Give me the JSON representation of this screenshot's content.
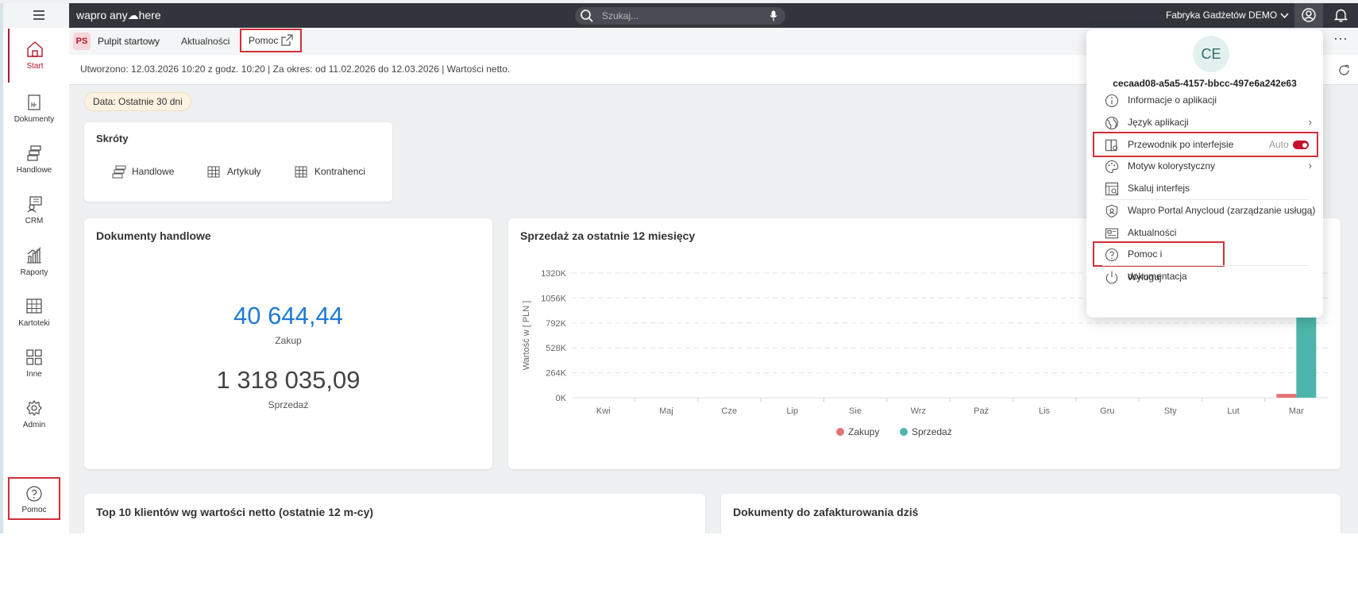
{
  "topbar": {
    "menu_icon": "hamburger-icon",
    "logo": "wapro any☁here",
    "search_placeholder": "Szukaj...",
    "company": "Fabryka Gadżetów DEMO"
  },
  "sidebar": {
    "items": [
      {
        "label": "Start",
        "icon": "home-icon"
      },
      {
        "label": "Dokumenty",
        "icon": "document-icon"
      },
      {
        "label": "Handlowe",
        "icon": "trade-icon"
      },
      {
        "label": "CRM",
        "icon": "crm-icon"
      },
      {
        "label": "Raporty",
        "icon": "chart-icon"
      },
      {
        "label": "Kartoteki",
        "icon": "grid-icon"
      },
      {
        "label": "Inne",
        "icon": "apps-icon"
      },
      {
        "label": "Admin",
        "icon": "admin-gear-icon"
      },
      {
        "label": "Pomoc",
        "icon": "help-icon"
      }
    ]
  },
  "tabs": {
    "badge": "PS",
    "items": [
      "Pulpit startowy",
      "Aktualności",
      "Pomoc"
    ]
  },
  "info": {
    "text": "Utworzono: 12.03.2026 10:20 z godz. 10:20 | Za okres: od 11.02.2026 do 12.03.2026 | Wartości netto."
  },
  "filter_chip": "Data: Ostatnie 30 dni",
  "shortcuts": {
    "title": "Skróty",
    "items": [
      "Handlowe",
      "Artykuły",
      "Kontrahenci"
    ]
  },
  "docs_card": {
    "title": "Dokumenty handlowe",
    "purchase_value": "40 644,44",
    "purchase_label": "Zakup",
    "sales_value": "1 318 035,09",
    "sales_label": "Sprzedaż"
  },
  "sales_card": {
    "title": "Sprzedaż za ostatnie 12 miesięcy"
  },
  "chart_data": {
    "type": "bar",
    "title": "Sprzedaż za ostatnie 12 miesięcy",
    "ylabel": "Wartość w [ PLN ]",
    "xlabel": "",
    "categories": [
      "Kwi",
      "Maj",
      "Cze",
      "Lip",
      "Sie",
      "Wrz",
      "Paź",
      "Lis",
      "Gru",
      "Sty",
      "Lut",
      "Mar"
    ],
    "yticks": [
      "0K",
      "264K",
      "528K",
      "792K",
      "1056K",
      "1320K"
    ],
    "ylim": [
      0,
      1320000
    ],
    "grid": true,
    "legend": "bottom",
    "series": [
      {
        "name": "Zakupy",
        "color": "#e57373",
        "values": [
          0,
          0,
          0,
          0,
          0,
          0,
          0,
          0,
          0,
          0,
          0,
          40644.44
        ]
      },
      {
        "name": "Sprzedaż",
        "color": "#4db6ac",
        "values": [
          0,
          0,
          0,
          0,
          0,
          0,
          0,
          0,
          0,
          0,
          0,
          1318035.09
        ]
      }
    ]
  },
  "bottom_cards": {
    "left_title": "Top 10 klientów wg wartości netto (ostatnie 12 m-cy)",
    "right_title": "Dokumenty do zafakturowania dziś"
  },
  "user_menu": {
    "initials": "CE",
    "user_id": "cecaad08-a5a5-4157-bbcc-497e6a242e63",
    "items": [
      {
        "label": "Informacje o aplikacji",
        "icon": "info-icon"
      },
      {
        "label": "Język aplikacji",
        "icon": "globe-icon"
      },
      {
        "label": "Przewodnik po interfejsie",
        "icon": "guide-icon",
        "toggle_label": "Auto"
      },
      {
        "label": "Motyw kolorystyczny",
        "icon": "palette-icon"
      },
      {
        "label": "Skaluj interfejs",
        "icon": "scale-icon"
      },
      {
        "label": "Wapro Portal Anycloud (zarządzanie usługą)",
        "icon": "shield-icon"
      },
      {
        "label": "Aktualności",
        "icon": "news-icon"
      },
      {
        "label": "Pomoc i dokumentacja",
        "icon": "help-icon"
      },
      {
        "label": "Wyloguj",
        "icon": "power-icon"
      }
    ]
  },
  "colors": {
    "accent": "#b5182a",
    "topbar": "#33353d",
    "highlight": "#d32f3a",
    "purchase_blue": "#1e7ad4"
  }
}
